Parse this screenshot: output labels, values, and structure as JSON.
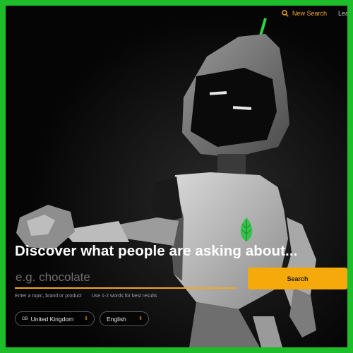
{
  "nav": {
    "new_search_label": "New Search",
    "learn_label": "Lea",
    "search_icon": "search-icon"
  },
  "hero": {
    "headline": "Discover what people are asking about...",
    "search_placeholder": "e.g. chocolate",
    "search_button": "Search",
    "hint_left": "Enter a topic, brand or product",
    "hint_right": "Use 1-2 words for best results"
  },
  "selectors": {
    "region_code": "GB",
    "region_label": "United Kingdom",
    "language_label": "English",
    "chevron_icon": "up-down-chevron-icon"
  },
  "colors": {
    "border": "#1ebd2a",
    "accent": "#f5a623",
    "button": "#f5a90b",
    "background": "#050505",
    "leaf": "#36c24a"
  }
}
